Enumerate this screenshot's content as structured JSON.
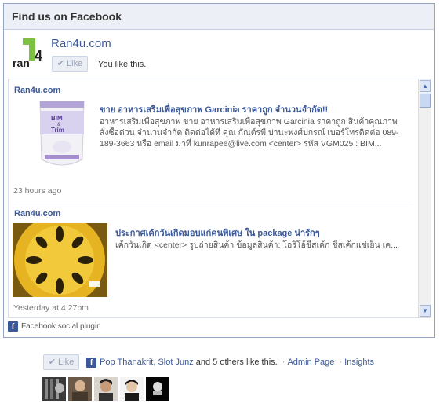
{
  "widget": {
    "header_title": "Find us on Facebook",
    "page_name": "Ran4u.com",
    "like_label": "Like",
    "you_like_text": "You like this.",
    "logo_text": "ran4u"
  },
  "posts": [
    {
      "author": "Ran4u.com",
      "title": "ขาย อาหารเสริมเพื่อสุขภาพ Garcinia ราคาถูก จำนวนจำกัด!!",
      "body": "อาหารเสริมเพื่อสุขภาพ ขาย อาหารเสริมเพื่อสุขภาพ Garcinia ราคาถูก สินค้าคุณภาพ สั่งซื้อด่วน จำนวนจำกัด  ติดต่อได้ที่ คุณ กัณต์รพี ปานะพงศ์ปกรณ์ เบอร์โทรติดต่อ 089-189-3663 หรือ email มาที่ kunrapee@live.com   <center> รหัส VGM025 : BIM...",
      "time": "23 hours ago",
      "thumb_text_1": "BIM",
      "thumb_text_2": "&",
      "thumb_text_3": "Trim"
    },
    {
      "author": "Ran4u.com",
      "title": "ประกาศเค้กวันเกิดมอบแก่คนพิเศษ ใน package น่ารักๆ",
      "body": "เค้กวันเกิด <center> รูปถ่ายสินค้า ข้อมูลสินค้า: โอริโอ้ชีสเค้ก ชีสเค้กแช่เย็น เค...",
      "time": "Yesterday at 4:27pm"
    }
  ],
  "footer": {
    "plugin_label": "Facebook social plugin"
  },
  "bottom": {
    "like_label": "Like",
    "friends_text": "Pop Thanakrit, Slot Junz",
    "others_text": " and 5 others like this.",
    "admin_link": "Admin Page",
    "insights_link": "Insights",
    "separator": "·"
  },
  "colors": {
    "fb_blue": "#3b5998",
    "header_bg": "#eceff5",
    "border": "#94a3c4"
  },
  "icons": {
    "check": "check-icon",
    "facebook": "facebook-icon",
    "scroll_up": "scroll-up-icon",
    "scroll_down": "scroll-down-icon"
  }
}
